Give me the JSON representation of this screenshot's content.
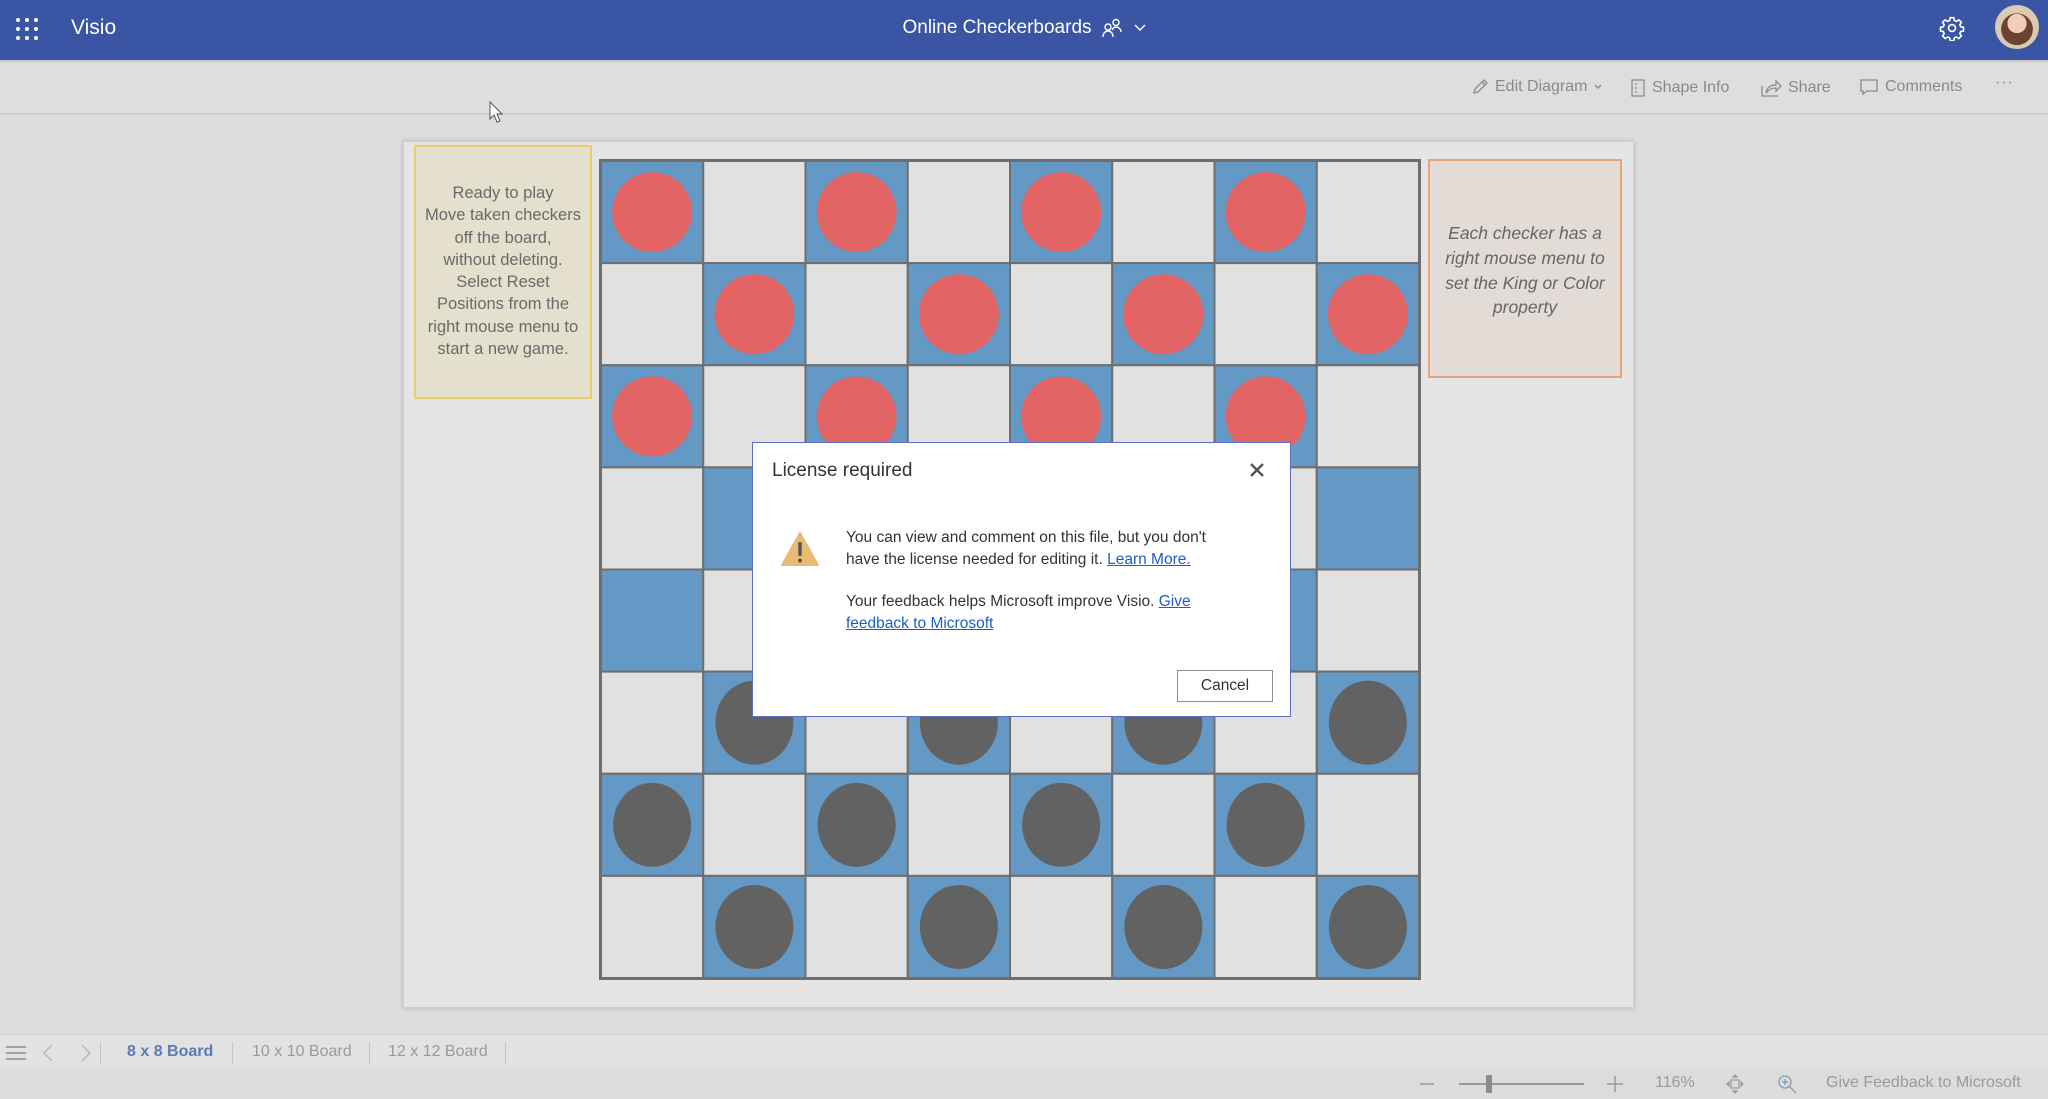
{
  "header": {
    "app_name": "Visio",
    "doc_title": "Online Checkerboards",
    "icons": [
      "app-launcher-icon",
      "people-icon",
      "chevron-down-icon",
      "gear-icon",
      "avatar"
    ]
  },
  "toolbar": {
    "edit_diagram": "Edit Diagram",
    "shape_info": "Shape Info",
    "share": "Share",
    "comments": "Comments",
    "more": "···"
  },
  "canvas": {
    "note_left": {
      "lines": [
        "Ready to play",
        "Move taken checkers",
        "off the board,",
        "without deleting.",
        "Select Reset",
        "Positions from the",
        "right mouse menu to",
        "start a new game."
      ]
    },
    "note_right": {
      "lines": [
        "Each checker has a",
        "right mouse menu to",
        "set the King or Color",
        "property"
      ]
    },
    "board": {
      "size": 8,
      "colors": {
        "dark_square": "#6399c4",
        "light_square": "#e1e1e1",
        "red_checker": "#e26464",
        "black_checker": "#626262",
        "grid": "#6e6e6e"
      },
      "pieces": [
        [
          "R",
          "",
          "R",
          "",
          "R",
          "",
          "R",
          ""
        ],
        [
          "",
          "R",
          "",
          "R",
          "",
          "R",
          "",
          "R"
        ],
        [
          "R",
          "",
          "R",
          "",
          "R",
          "",
          "R",
          ""
        ],
        [
          "",
          "",
          "",
          "",
          "",
          "",
          "",
          ""
        ],
        [
          "",
          "",
          "",
          "",
          "",
          "",
          "",
          ""
        ],
        [
          "",
          "B",
          "",
          "B",
          "",
          "B",
          "",
          "B"
        ],
        [
          "B",
          "",
          "B",
          "",
          "B",
          "",
          "B",
          ""
        ],
        [
          "",
          "B",
          "",
          "B",
          "",
          "B",
          "",
          "B"
        ]
      ]
    }
  },
  "dialog": {
    "title": "License required",
    "message_line1": "You can view and comment on this file, but you don't",
    "message_line2": "have the license needed for editing it.",
    "learn_more": "Learn More.",
    "feedback_text": "Your feedback helps Microsoft improve Visio.",
    "feedback_link_part1": "Give",
    "feedback_link_part2": "feedback to Microsoft",
    "cancel": "Cancel",
    "warning_color": "#e8bb75"
  },
  "tabs": {
    "items": [
      {
        "label": "8 x 8 Board",
        "active": true
      },
      {
        "label": "10 x 10 Board",
        "active": false
      },
      {
        "label": "12 x 12 Board",
        "active": false
      }
    ]
  },
  "status": {
    "zoom_level": "116%",
    "zoom_slider_fraction": 0.24,
    "feedback": "Give Feedback to Microsoft"
  }
}
